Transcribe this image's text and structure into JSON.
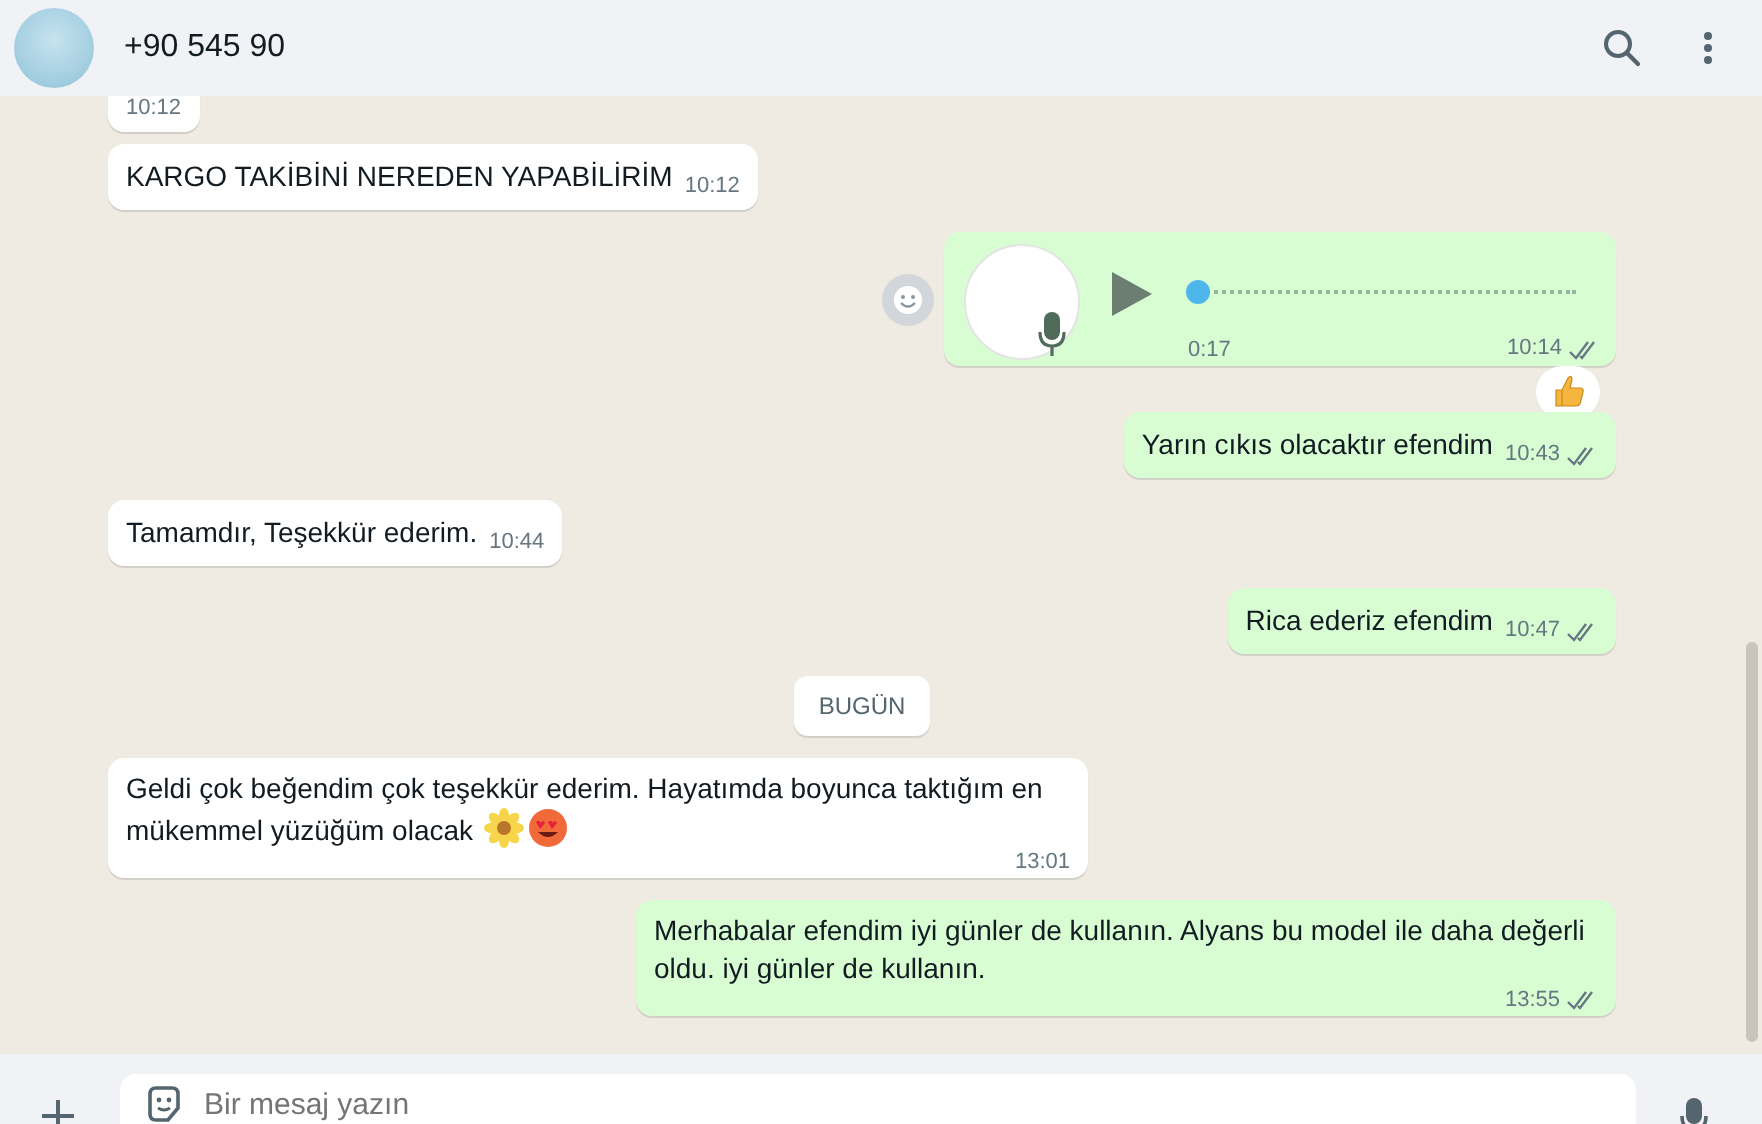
{
  "header": {
    "contact": "+90 545 90"
  },
  "messages": [
    {
      "kind": "text",
      "outgoing": false,
      "time": "10:12"
    },
    {
      "kind": "text",
      "outgoing": false,
      "text": "KARGO TAKİBİNİ NEREDEN YAPABİLİRİM",
      "time": "10:12"
    },
    {
      "kind": "voice",
      "outgoing": true,
      "duration": "0:17",
      "time": "10:14",
      "read": true,
      "level": 0,
      "reacted": true
    },
    {
      "kind": "text",
      "outgoing": true,
      "text": "Yarın cıkıs olacaktır efendim",
      "time": "10:43",
      "read": true
    },
    {
      "kind": "text",
      "outgoing": false,
      "text": "Tamamdır, Teşekkür ederim.",
      "time": "10:44"
    },
    {
      "kind": "text",
      "outgoing": true,
      "text": "Rica ederiz efendim",
      "time": "10:47",
      "read": true
    },
    {
      "kind": "date",
      "text": "BUGÜN"
    },
    {
      "kind": "text",
      "outgoing": false,
      "text": "Geldi çok beğendim çok teşekkür ederim. Hayatımda boyunca taktığım en mükemmel yüzüğüm olacak",
      "emojis": [
        {
          "kind": "flower"
        },
        {
          "kind": "heart-eyes"
        }
      ],
      "time": "13:01",
      "wide": true
    },
    {
      "kind": "text",
      "outgoing": true,
      "text": "Merhabalar efendim iyi günler de kullanın. Alyans bu model ile daha değerli oldu. iyi günler de kullanın.",
      "time": "13:55",
      "read": true,
      "wide": true
    }
  ],
  "composer": {
    "placeholder": "Bir mesaj yazın"
  }
}
